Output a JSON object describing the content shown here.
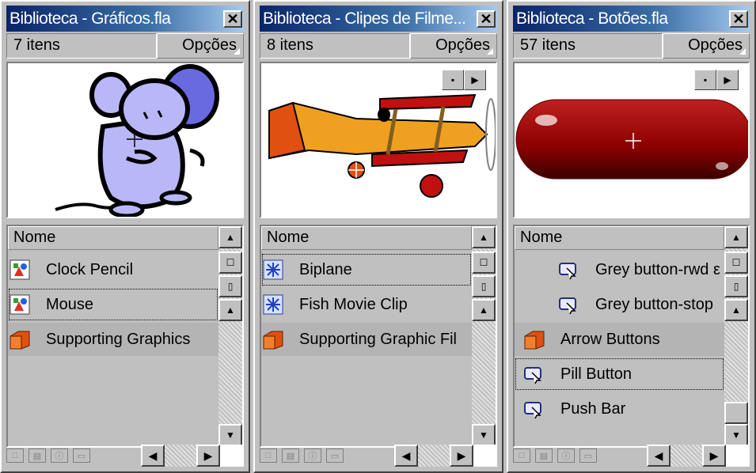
{
  "panels": [
    {
      "title": "Biblioteca - Gráficos.fla",
      "count": "7 itens",
      "options": "Opções",
      "header": "Nome",
      "items": [
        {
          "label": "Clock Pencil",
          "icon": "graphic-symbol-icon"
        },
        {
          "label": "Mouse",
          "icon": "graphic-symbol-icon"
        },
        {
          "label": "Supporting Graphics",
          "icon": "folder-icon"
        }
      ]
    },
    {
      "title": "Biblioteca - Clipes de Filme...",
      "count": "8 itens",
      "options": "Opções",
      "header": "Nome",
      "items": [
        {
          "label": "Biplane",
          "icon": "movie-clip-icon"
        },
        {
          "label": "Fish Movie Clip",
          "icon": "movie-clip-icon"
        },
        {
          "label": "Supporting Graphic Fil",
          "icon": "folder-icon"
        }
      ]
    },
    {
      "title": "Biblioteca - Botões.fla",
      "count": "57 itens",
      "options": "Opções",
      "header": "Nome",
      "items": [
        {
          "label": "Grey button-rwd ε",
          "icon": "button-symbol-icon"
        },
        {
          "label": "Grey button-stop",
          "icon": "button-symbol-icon"
        },
        {
          "label": "Arrow Buttons",
          "icon": "folder-icon"
        },
        {
          "label": "Pill Button",
          "icon": "button-symbol-icon"
        },
        {
          "label": "Push Bar",
          "icon": "button-symbol-icon"
        }
      ]
    }
  ],
  "colors": {
    "titlebar_start": "#0a246a",
    "titlebar_end": "#a6caf0",
    "mouse_fill": "#b8b8f8",
    "plane_orange": "#f0a020",
    "pill_red": "#8b0000"
  }
}
